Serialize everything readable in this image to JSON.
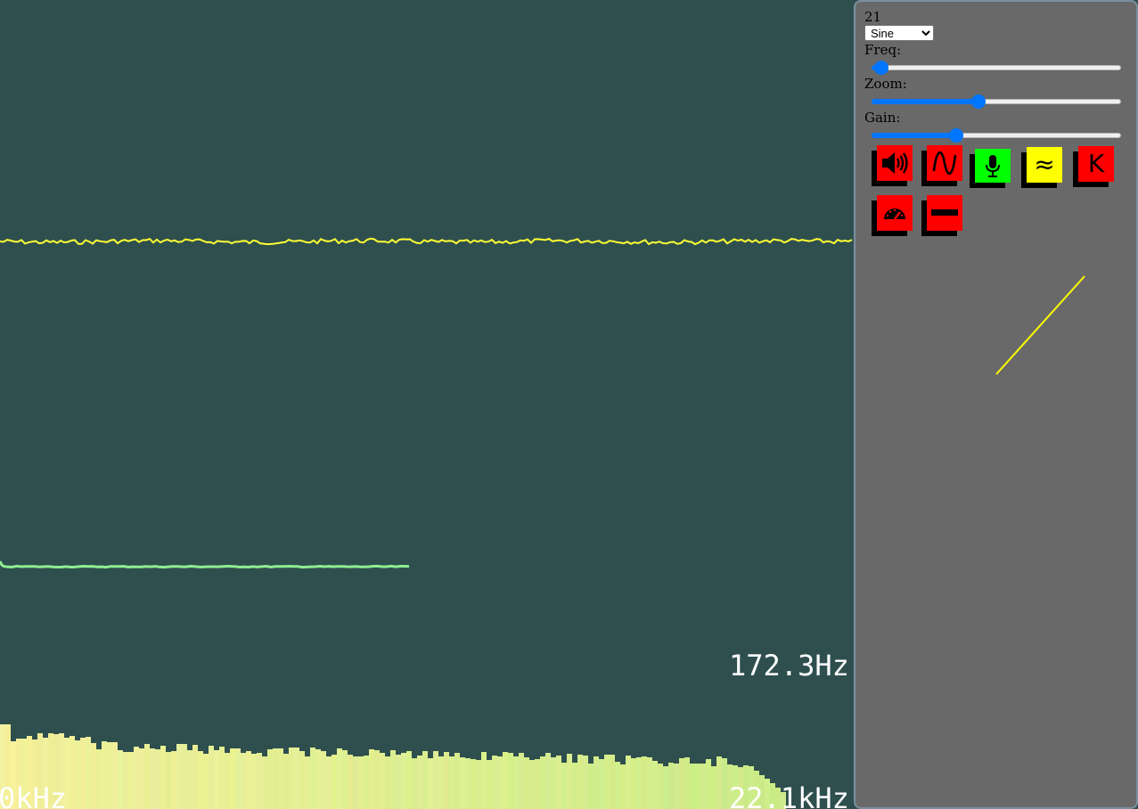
{
  "display": {
    "frequency_readout": "172.3Hz",
    "spectrum_min_label": "0kHz",
    "spectrum_max_label": "22.1kHz",
    "background_color": "#2f4f4f",
    "waveform_color": "#ffff33",
    "fft_line_color": "#90ee90"
  },
  "panel": {
    "counter": "21",
    "waveform": {
      "selected": "Sine"
    },
    "freq_label": "Freq:",
    "zoom_label": "Zoom:",
    "gain_label": "Gain:",
    "freq_level_pct": 4,
    "zoom_level_pct": 43,
    "gain_level_pct": 34,
    "buttons": [
      {
        "name": "speaker-toggle-button",
        "icon": "speaker-volume-icon",
        "color": "#ff0000"
      },
      {
        "name": "sine-wave-button",
        "icon": "sine-wave-icon",
        "color": "#ff0000"
      },
      {
        "name": "microphone-button",
        "icon": "microphone-icon",
        "color": "#00ff00"
      },
      {
        "name": "approx-button",
        "icon": "approx-icon",
        "color": "#ffff00",
        "glyph": "≈"
      },
      {
        "name": "k-button",
        "icon": "letter-k-icon",
        "color": "#ff0000",
        "glyph": "K"
      },
      {
        "name": "speedometer-button",
        "icon": "speedometer-icon",
        "color": "#ff0000"
      },
      {
        "name": "minus-button",
        "icon": "minus-icon",
        "color": "#ff0000"
      }
    ],
    "lissajous_color": "#ffff00",
    "panel_color": "#696969"
  }
}
